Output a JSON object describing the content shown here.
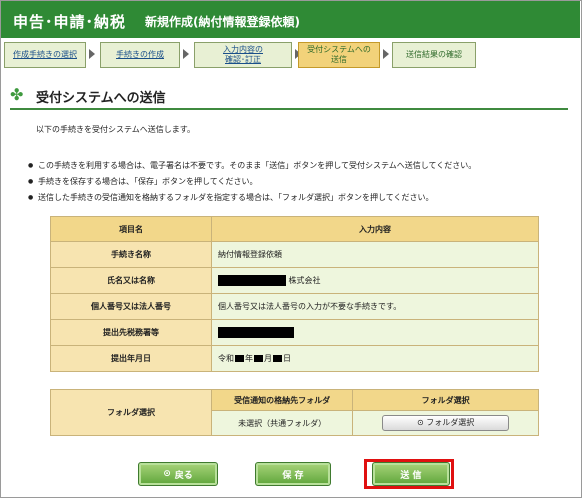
{
  "header": {
    "category": "申告･申請･納税",
    "subtitle": "新規作成(納付情報登録依頼)"
  },
  "steps": [
    {
      "label_1": "作成手続きの選択",
      "label_2": ""
    },
    {
      "label_1": "手続きの作成",
      "label_2": ""
    },
    {
      "label_1": "入力内容の",
      "label_2": "確認･訂正"
    },
    {
      "label_1": "受付システムへの",
      "label_2": "送信"
    },
    {
      "label_1": "送信結果の確認",
      "label_2": ""
    }
  ],
  "section": {
    "title": "受付システムへの送信"
  },
  "intro": "以下の手続きを受付システムへ送信します。",
  "notes": [
    "この手続きを利用する場合は、電子署名は不要です。そのまま「送信」ボタンを押して受付システムへ送信してください。",
    "手続きを保存する場合は、「保存」ボタンを押してください。",
    "送信した手続きの受信通知を格納するフォルダを指定する場合は、「フォルダ選択」ボタンを押してください。"
  ],
  "info_table": {
    "header_item": "項目名",
    "header_value": "入力内容",
    "rows": [
      {
        "label": "手続き名称",
        "value": "納付情報登録依頼"
      },
      {
        "label": "氏名又は名称",
        "value": "株式会社"
      },
      {
        "label": "個人番号又は法人番号",
        "value": "個人番号又は法人番号の入力が不要な手続きです。"
      },
      {
        "label": "提出先税務署等",
        "value": ""
      },
      {
        "label": "提出年月日",
        "value_prefix": "令和",
        "value_year": "年",
        "value_month": "月",
        "value_day": "日"
      }
    ]
  },
  "folder_table": {
    "label": "フォルダ選択",
    "col1_header": "受信通知の格納先フォルダ",
    "col2_header": "フォルダ選択",
    "current_folder": "未選択（共通フォルダ）",
    "button_label": "フォルダ選択"
  },
  "buttons": {
    "back": "戻る",
    "save": "保 存",
    "send": "送 信"
  },
  "colors": {
    "header_bg": "#2f8a35",
    "current_step": "#f2d27a",
    "highlight": "#e01010"
  }
}
